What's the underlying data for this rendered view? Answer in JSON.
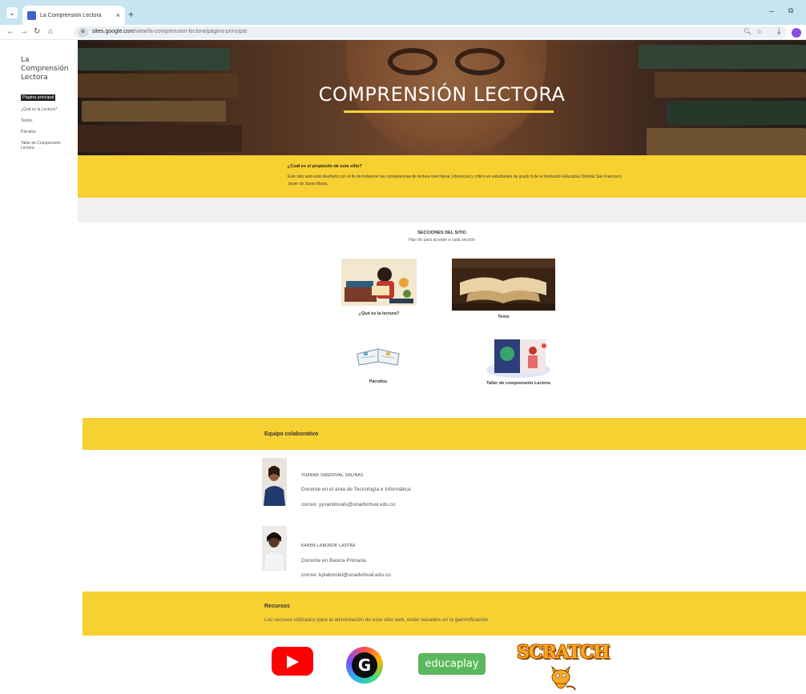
{
  "browser": {
    "tab_title": "La Comprensión Lectora",
    "new_tab_symbol": "+",
    "tab_close_symbol": "×",
    "url_domain": "sites.google.com",
    "url_path": "/view/la-comprension-lectora/página-principal"
  },
  "sidebar": {
    "site_title": "La Comprensión Lectora",
    "items": [
      {
        "label": "Página principal",
        "active": true
      },
      {
        "label": "¿Qué es la Lectura?",
        "active": false
      },
      {
        "label": "Textos",
        "active": false
      },
      {
        "label": "Párrafos",
        "active": false
      },
      {
        "label": "Taller de Comprensión Lectora",
        "active": false
      }
    ]
  },
  "hero": {
    "title": "COMPRENSIÓN LECTORA"
  },
  "purpose": {
    "question": "¿Cuál es el propósito de este sitio?",
    "text": "Este sitio web está diseñado con el fin de fortalecer las competencias de lectura nivel literal, inferencial y crítico en estudiantes de grado 8 de la Institución Educativa Distrital San Francisco Javier de Santa Marta."
  },
  "sections": {
    "title": "SECCIONES DEL SITIO",
    "subtitle": "Haz clic para acceder a cada sección",
    "cards": [
      {
        "label": "¿Qué es la lectura?"
      },
      {
        "label": "Texto"
      },
      {
        "label": "Párrafos"
      },
      {
        "label": "Taller de comprensión Lectora"
      }
    ]
  },
  "team": {
    "title": "Equipo colaborativo",
    "members": [
      {
        "name": "YOANNA SANDOVAL SALINAS",
        "role": "Docente en el área de Tecnología e Informática",
        "email": "correo: yysandovals@unadvirtual.edu.co"
      },
      {
        "name": "KAREN LABORDE LASTRA",
        "role": "Docente en Basica Primaria",
        "email": "correo: kplabordel@unadvirtual.edu.co"
      }
    ]
  },
  "resources": {
    "title": "Recursos",
    "text": "Los recusos utilizados para la alimentación de este sitio web, están basados en la gammificación",
    "logos": {
      "genially_letter": "G",
      "educaplay": "educaplay",
      "scratch": "SCRATCH"
    }
  },
  "colors": {
    "accent_yellow": "#f7d032",
    "youtube_red": "#ff0000",
    "educaplay_green": "#5cb85c"
  }
}
